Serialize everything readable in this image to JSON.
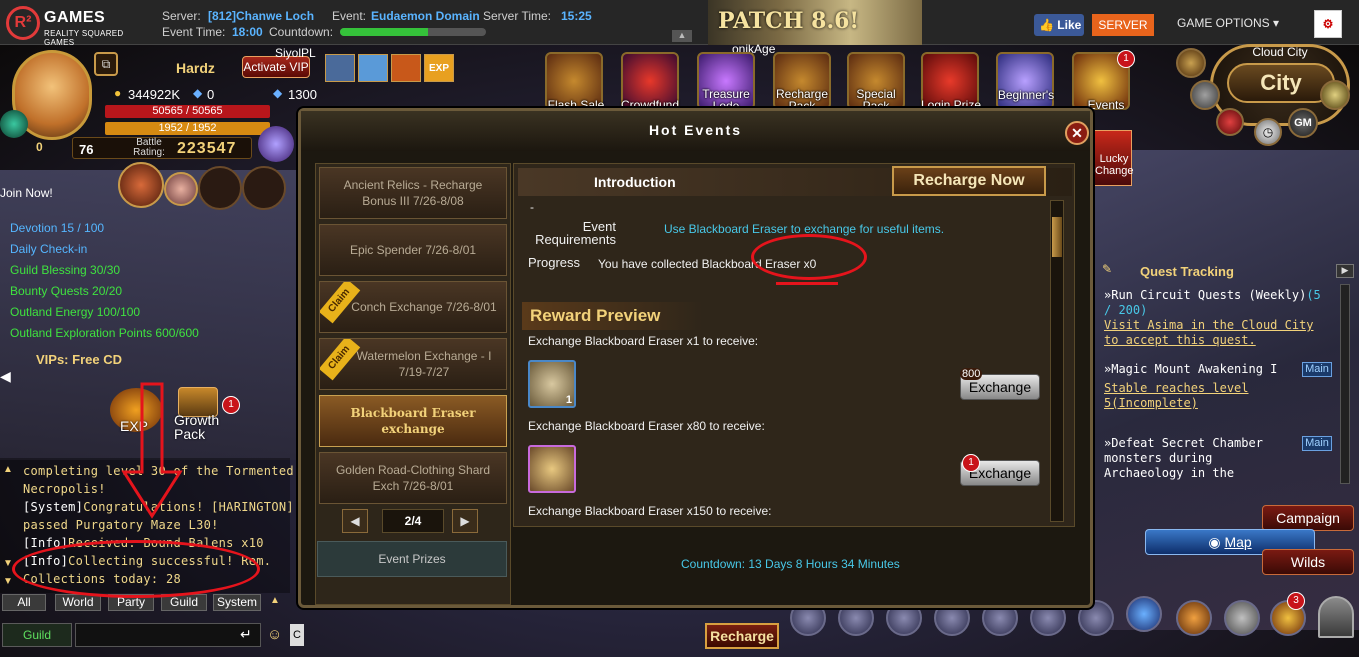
{
  "topbar": {
    "brand": "GAMES",
    "brand_sub": "REALITY SQUARED GAMES",
    "server_label": "Server:",
    "server_value": "[812]Chanwe Loch",
    "event_label": "Event:",
    "event_value": "Eudaemon Domain",
    "server_time_label": "Server Time:",
    "server_time_value": "15:25",
    "event_time_label": "Event Time:",
    "event_time_value": "18:00",
    "countdown_label": "Countdown:",
    "patch": "PATCH 8.6!",
    "like": "Like",
    "server_btn": "SERVER",
    "game_options": "GAME OPTIONS ▾"
  },
  "player": {
    "name": "Hardz",
    "activate_vip": "Activate VIP",
    "gold": "344922K",
    "diamonds": "0",
    "other_currency": "1300",
    "hp": "50565 / 50565",
    "mp": "1952 / 1952",
    "level": "76",
    "left_num": "0",
    "rating_label": "Battle Rating:",
    "rating": "223547",
    "join_now": "Join Now!"
  },
  "quests_left": [
    {
      "text": "Devotion 15 / 100",
      "color": "blue"
    },
    {
      "text": "Daily Check-in",
      "color": "blue"
    },
    {
      "text": "Guild Blessing 30/30",
      "color": "green"
    },
    {
      "text": "Bounty Quests 20/20",
      "color": "green"
    },
    {
      "text": "Outland Energy 100/100",
      "color": "green"
    },
    {
      "text": "Outland Exploration Points 600/600",
      "color": "green"
    }
  ],
  "vip_text": "VIPs: Free CD",
  "exp_label": "EXP",
  "growth_pack": "Growth Pack",
  "growth_badge": "1",
  "chat": {
    "lines": [
      {
        "tag": "",
        "text": "completing level 30 of the Tormented"
      },
      {
        "tag": "",
        "text": "Necropolis!"
      },
      {
        "tag": "[System]",
        "text": "Congratulations! [HARINGTON] j"
      },
      {
        "tag": "",
        "text": "passed Purgatory Maze L30!"
      },
      {
        "tag": "[Info]",
        "text": "Received: Bound Balens x10"
      },
      {
        "tag": "[Info]",
        "text": "Collecting successful! Rem."
      },
      {
        "tag": "",
        "text": "Collections today: 28"
      }
    ],
    "tabs": [
      "All",
      "World",
      "Party",
      "Guild",
      "System"
    ],
    "guild_btn": "Guild"
  },
  "event_icons": [
    {
      "label": "Flash Sale"
    },
    {
      "label": "Crowdfund"
    },
    {
      "label": "Treasure Lode"
    },
    {
      "label": "Recharge Pack"
    },
    {
      "label": "Special Pack"
    },
    {
      "label": "Login Prize"
    },
    {
      "label": "Beginner's"
    },
    {
      "label": "Events",
      "badge": "1"
    }
  ],
  "top_names": {
    "left": "SiyolPL",
    "right": "onikAge",
    "city_name": "Cloud City"
  },
  "modal": {
    "title": "Hot Events",
    "close": "✕",
    "events": [
      {
        "label": "Ancient Relics - Recharge Bonus III 7/26-8/08",
        "claim": false,
        "selected": false
      },
      {
        "label": "Epic Spender 7/26-8/01",
        "claim": false,
        "selected": false
      },
      {
        "label": "Conch Exchange 7/26-8/01",
        "claim": true,
        "selected": false
      },
      {
        "label": "Watermelon Exchange - I 7/19-7/27",
        "claim": true,
        "selected": false
      },
      {
        "label": "Blackboard Eraser exchange",
        "claim": false,
        "selected": true
      },
      {
        "label": "Golden Road-Clothing Shard Exch 7/26-8/01",
        "claim": false,
        "selected": false
      }
    ],
    "claim_label": "Claim",
    "page": "2/4",
    "prev": "◀",
    "next": "▶",
    "event_prizes": "Event Prizes",
    "intro_title": "Introduction",
    "recharge_now": "Recharge Now",
    "dash": "-",
    "req_label": "Event Requirements",
    "req_value": "Use Blackboard Eraser to exchange for useful items.",
    "progress_label": "Progress",
    "progress_value": "You have collected Blackboard Eraser x0",
    "reward_title": "Reward Preview",
    "rewards": [
      {
        "text": "Exchange Blackboard Eraser x1 to receive:",
        "count": "1",
        "badge": "800",
        "btn": "Exchange"
      },
      {
        "text": "Exchange Blackboard Eraser x80 to receive:",
        "count": "",
        "badge": "1",
        "btn": "Exchange"
      },
      {
        "text": "Exchange Blackboard Eraser x150 to receive:",
        "count": "",
        "badge": "",
        "btn": ""
      }
    ],
    "countdown": "Countdown: 13 Days 8 Hours 34 Minutes"
  },
  "right": {
    "city": "City",
    "gm": "GM",
    "quest_tracking": "Quest Tracking",
    "quests": [
      {
        "title": "Run Circuit Quests (Weekly)",
        "progress": "(5 / 200)",
        "link": "Visit Asima in the Cloud City to accept this quest.",
        "main": ""
      },
      {
        "title": "Magic Mount Awakening I",
        "progress": "",
        "link": "Stable reaches level 5(Incomplete)",
        "main": "Main"
      },
      {
        "title": "Defeat Secret Chamber monsters during Archaeology in the",
        "progress": "",
        "link": "",
        "main": "Main"
      }
    ],
    "campaign": "Campaign",
    "map": "Map",
    "wilds": "Wilds",
    "lucky": "Lucky Change",
    "bottom_badge": "3",
    "recharge": "Recharge"
  },
  "colors": {
    "accent_gold": "#f2d27a",
    "cyan": "#48c8e8",
    "annotation_red": "#e5141c"
  }
}
